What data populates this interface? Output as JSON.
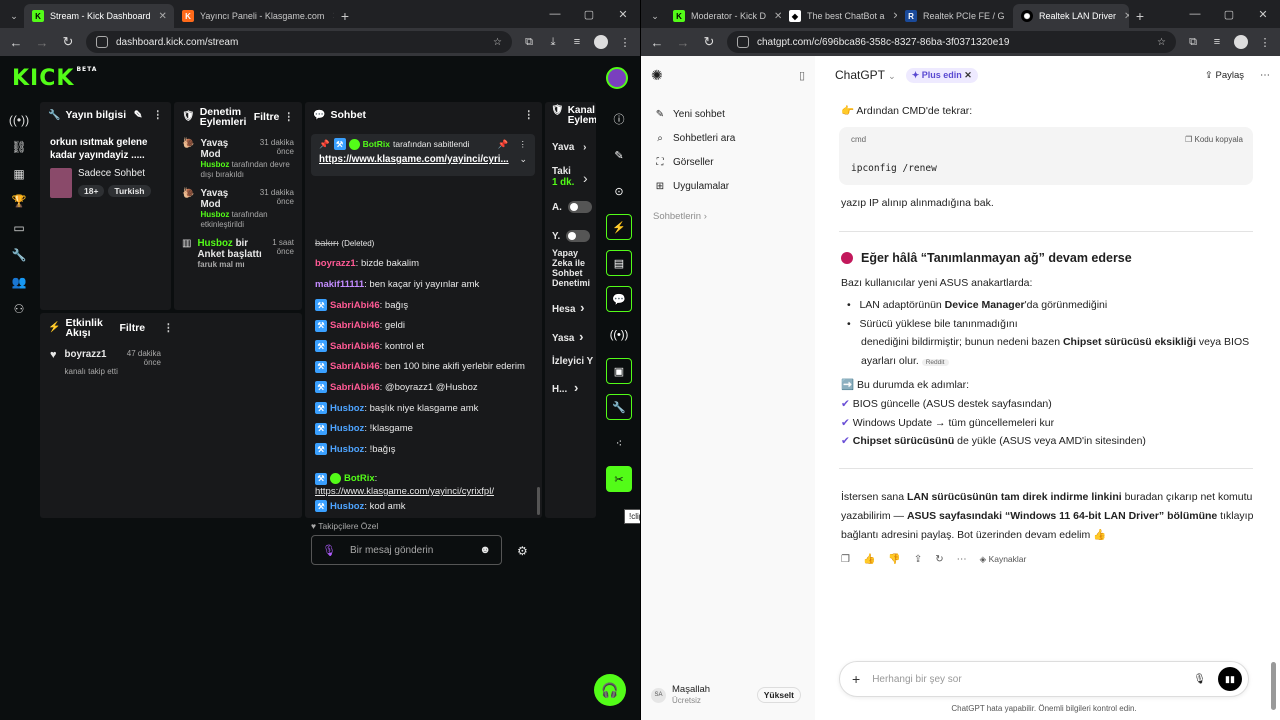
{
  "left_window": {
    "tabs": [
      {
        "title": "Stream - Kick Dashboard",
        "active": true
      },
      {
        "title": "Yayıncı Paneli - Klasgame.com",
        "active": false
      }
    ],
    "url": "dashboard.kick.com/stream"
  },
  "right_window": {
    "tabs": [
      {
        "title": "Moderator - Kick D",
        "active": false
      },
      {
        "title": "The best ChatBot a",
        "active": false
      },
      {
        "title": "Realtek PCIe FE / G",
        "active": false
      },
      {
        "title": "Realtek LAN Driver",
        "active": true
      }
    ],
    "url": "chatgpt.com/c/696bca86-358c-8327-86ba-3f0371320e19"
  },
  "kick": {
    "logo": "KICK",
    "logo_beta": "BETA",
    "stream_info": {
      "title": "Yayın bilgisi",
      "stream_title": "orkun ısıtmak gelene kadar yayındayiz .....",
      "category": "Sadece Sohbet",
      "tags": [
        "18+",
        "Turkish"
      ]
    },
    "mod_actions": {
      "title": "Denetim Eylemleri",
      "filter": "Filtre",
      "items": [
        {
          "action": "Yavaş Mod",
          "time": "31 dakika önce",
          "by": "Husboz",
          "detail": "tarafından devre dışı bırakıldı"
        },
        {
          "action": "Yavaş Mod",
          "time": "31 dakika önce",
          "by": "Husboz",
          "detail": "tarafından etkinleştirildi"
        },
        {
          "action_by": "Husboz",
          "action": "bir Anket başlattı",
          "time": "1 saat önce",
          "detail": "faruk mal mı"
        }
      ]
    },
    "activity": {
      "title": "Etkinlik Akışı",
      "filter": "Filtre",
      "items": [
        {
          "user": "boyrazz1",
          "time": "47 dakika önce",
          "detail": "kanalı takip etti"
        }
      ]
    },
    "chat": {
      "title": "Sohbet",
      "pinned_by": "BotRix",
      "pinned_label": "tarafından sabitlendi",
      "pinned_link": "https://www.klasgame.com/yayinci/cyri...",
      "messages": [
        {
          "user": "bakırı",
          "text": "(Deleted)",
          "color": "muted",
          "badge": false
        },
        {
          "user": "boyrazz1",
          "text": "bizde bakalim",
          "color": "pink",
          "badge": false
        },
        {
          "user": "makif11111",
          "text": "ben kaçar iyi yayınlar amk",
          "color": "purple",
          "badge": false
        },
        {
          "user": "SabriAbi46",
          "text": "bağış",
          "color": "pink",
          "badge": true
        },
        {
          "user": "SabriAbi46",
          "text": "geldi",
          "color": "pink",
          "badge": true
        },
        {
          "user": "SabriAbi46",
          "text": "kontrol et",
          "color": "pink",
          "badge": true
        },
        {
          "user": "SabriAbi46",
          "text": "ben 100 bine akifi yerlebir ederim",
          "color": "pink",
          "badge": true
        },
        {
          "user": "SabriAbi46",
          "text": "@boyrazz1 @Husboz",
          "color": "pink",
          "badge": true
        },
        {
          "user": "Husboz",
          "text": "başlık niye klasgame amk",
          "color": "blue",
          "badge": true
        },
        {
          "user": "Husboz",
          "text": "!klasgame",
          "color": "blue",
          "badge": true
        },
        {
          "user": "Husboz",
          "text": "!bağış",
          "color": "blue",
          "badge": true
        }
      ],
      "botrix_user": "BotRix",
      "botrix_link": "https://www.klasgame.com/yayinci/cyrixfpl/",
      "last_message": {
        "user": "Husboz",
        "text": "kod amk"
      },
      "followers_only": "Takipçilere Özel",
      "input_placeholder": "Bir mesaj gönderin"
    },
    "channel_actions": {
      "title": "Kanal Eylemleri",
      "rows": [
        {
          "label": "Yava"
        },
        {
          "label": "Taki",
          "sub": "1 dk."
        },
        {
          "label": "A."
        },
        {
          "label": "Y."
        },
        {
          "label": "Yapay Zeka ile Sohbet Denetimi"
        },
        {
          "label": "Hesa"
        },
        {
          "label": "Yasa"
        },
        {
          "label": "İzleyici Y"
        },
        {
          "label": "H..."
        }
      ]
    },
    "tooltip": "!clip command working"
  },
  "chatgpt": {
    "sidebar": {
      "items": [
        "Yeni sohbet",
        "Sohbetleri ara",
        "Görseller",
        "Uygulamalar"
      ],
      "section": "Sohbetlerin",
      "user_name": "Maşallah",
      "user_plan": "Ücretsiz",
      "user_initials": "SA",
      "upgrade": "Yükselt"
    },
    "header": {
      "model": "ChatGPT",
      "plus": "Plus edin",
      "share": "Paylaş"
    },
    "content": {
      "cmd_intro": "👉 Ardından CMD'de tekrar:",
      "code_lang": "cmd",
      "copy_label": "Kodu kopyala",
      "code": "ipconfig /renew",
      "ip_check": "yazıp IP alınıp alınmadığına bak.",
      "heading": "Eğer hâlâ “Tanımlanmayan ağ” devam ederse",
      "intro": "Bazı kullanıcılar yeni ASUS anakartlarda:",
      "bullet1_a": "LAN adaptörünün ",
      "bullet1_b": "Device Manager",
      "bullet1_c": "'da görünmediğini",
      "bullet2_a": "Sürücü yüklese bile tanınmadığını",
      "bullet2_b": "denediğini bildirmiştir; bunun nedeni bazen ",
      "bullet2_c": "Chipset sürücüsü eksikliği",
      "bullet2_d": " veya BIOS",
      "bullet2_e": "ayarları olur.",
      "source_chip": "Reddit",
      "steps_title": "➡️ Bu durumda ek adımlar:",
      "step1": "BIOS güncelle (ASUS destek sayfasından)",
      "step2": "Windows Update → tüm güncellemeleri kur",
      "step3_a": "Chipset sürücüsünü",
      "step3_b": " de yükle (ASUS veya AMD'in sitesinden)",
      "final_a": "İstersen sana ",
      "final_b": "LAN sürücüsünün tam direk indirme linkini",
      "final_c": " buradan çıkarıp net komutu",
      "final_d": "yazabilirim — ",
      "final_e": "ASUS sayfasındaki “Windows 11 64-bit LAN Driver” bölümüne",
      "final_f": " tıklayıp",
      "final_g": "bağlantı adresini paylaş. Bot üzerinden devam edelim 👍",
      "sources": "Kaynaklar"
    },
    "prompt_placeholder": "Herhangi bir şey sor",
    "disclaimer": "ChatGPT hata yapabilir. Önemli bilgileri kontrol edin."
  },
  "colors": {
    "kick_green": "#53fc18",
    "husboz_blue": "#4ea4ff",
    "sabri_pink": "#ff5a95"
  }
}
